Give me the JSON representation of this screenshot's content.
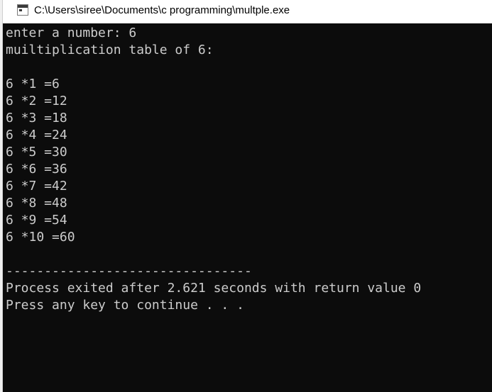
{
  "window": {
    "title": "C:\\Users\\siree\\Documents\\c programming\\multple.exe",
    "icon": "console-app-icon"
  },
  "console": {
    "lines": [
      "enter a number: 6",
      "muiltiplication table of 6:",
      "",
      "6 *1 =6",
      "6 *2 =12",
      "6 *3 =18",
      "6 *4 =24",
      "6 *5 =30",
      "6 *6 =36",
      "6 *7 =42",
      "6 *8 =48",
      "6 *9 =54",
      "6 *10 =60",
      "",
      "--------------------------------",
      "Process exited after 2.621 seconds with return value 0",
      "Press any key to continue . . ."
    ],
    "text_color": "#cccccc",
    "background_color": "#0c0c0c"
  }
}
